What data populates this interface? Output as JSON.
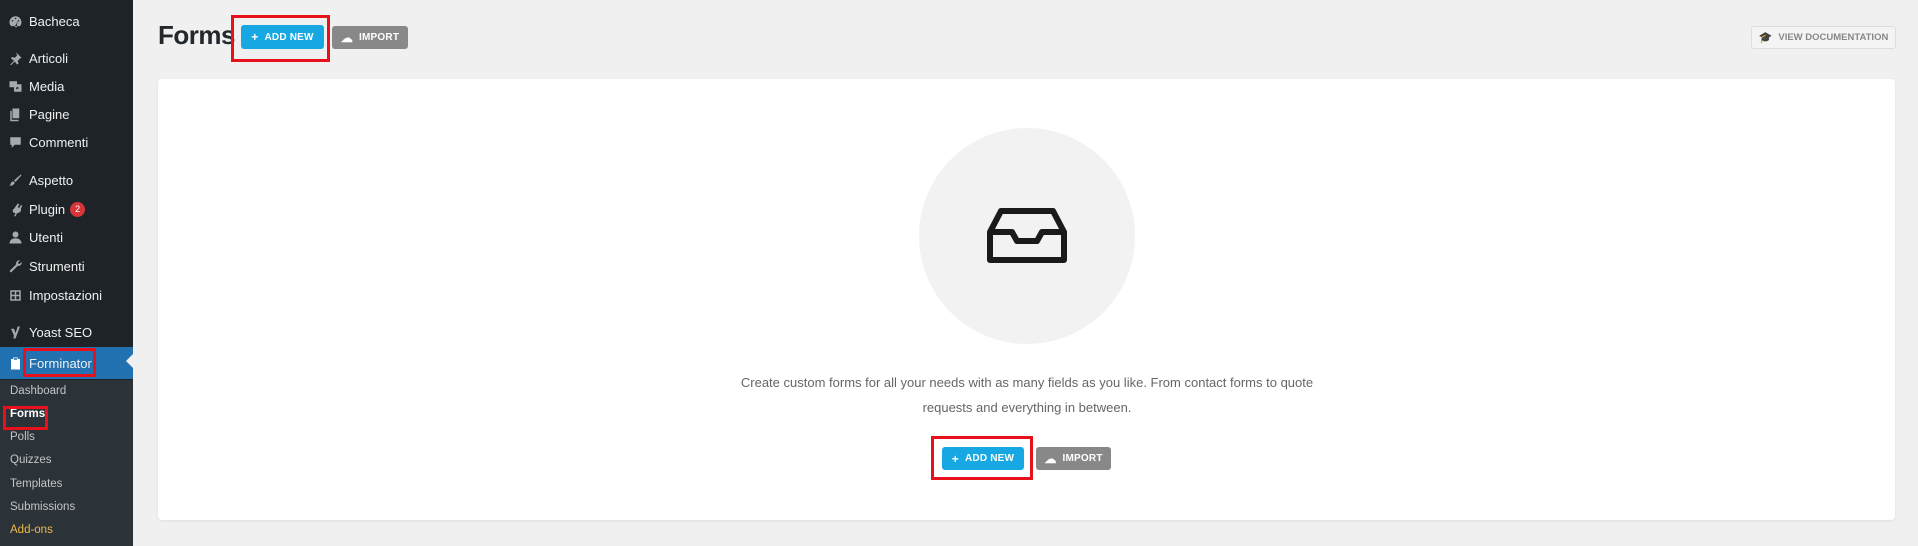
{
  "sidebar": {
    "items": [
      {
        "label": "Bacheca",
        "icon": "dashboard-icon"
      },
      {
        "label": "Articoli",
        "icon": "pin-icon"
      },
      {
        "label": "Media",
        "icon": "media-icon"
      },
      {
        "label": "Pagine",
        "icon": "page-icon"
      },
      {
        "label": "Commenti",
        "icon": "comment-icon"
      },
      {
        "label": "Aspetto",
        "icon": "brush-icon"
      },
      {
        "label": "Plugin",
        "icon": "plugin-icon",
        "badge": "2"
      },
      {
        "label": "Utenti",
        "icon": "user-icon"
      },
      {
        "label": "Strumenti",
        "icon": "wrench-icon"
      },
      {
        "label": "Impostazioni",
        "icon": "settings-icon"
      },
      {
        "label": "Yoast SEO",
        "icon": "yoast-icon"
      },
      {
        "label": "Forminator",
        "icon": "clipboard-icon"
      }
    ],
    "submenu": [
      "Dashboard",
      "Forms",
      "Polls",
      "Quizzes",
      "Templates",
      "Submissions",
      "Add-ons"
    ]
  },
  "header": {
    "title": "Forms",
    "add_new": "ADD NEW",
    "import": "IMPORT",
    "view_docs": "VIEW DOCUMENTATION"
  },
  "empty_state": {
    "description": "Create custom forms for all your needs with as many fields as you like. From contact forms to quote requests and everything in between.",
    "add_new": "ADD NEW",
    "import": "IMPORT"
  },
  "colors": {
    "sidebar_bg": "#1d2327",
    "active_bg": "#2271b1",
    "primary_button": "#17a8e3",
    "secondary_button": "#888888",
    "highlight": "#e8101a",
    "badge": "#d63638"
  }
}
